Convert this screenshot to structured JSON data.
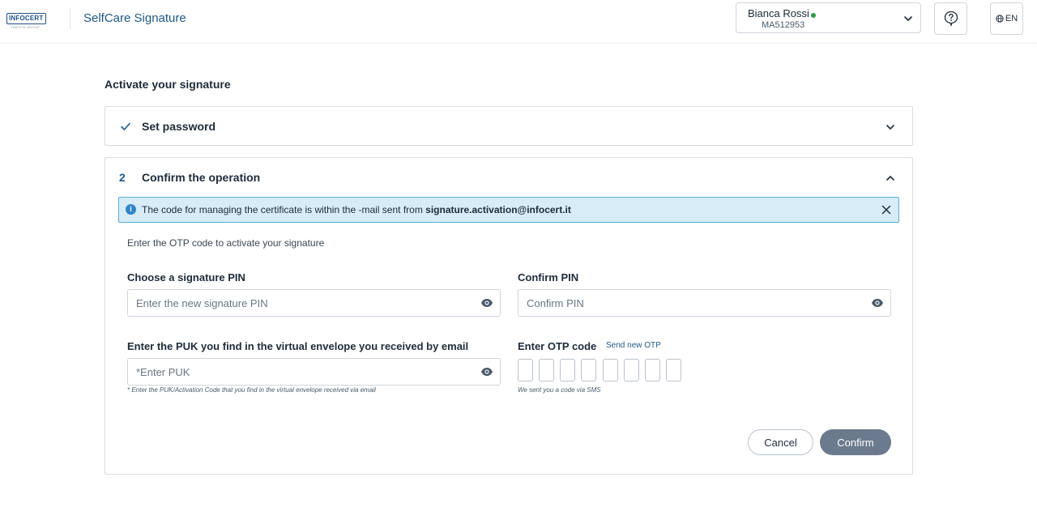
{
  "header": {
    "logo_text": "INFOCERT",
    "logo_sub": "TINEXTA GROUP",
    "app_title": "SelfCare Signature",
    "user": {
      "name": "Bianca Rossi",
      "id": "MA512953",
      "status_color": "#2e9a4a"
    },
    "language": "EN"
  },
  "page": {
    "title": "Activate your signature",
    "steps": [
      {
        "title": "Set password",
        "state": "completed"
      },
      {
        "number": "2",
        "title": "Confirm the operation",
        "state": "open"
      }
    ]
  },
  "banner": {
    "text": "The code for managing the certificate is within the -mail sent from ",
    "email": "signature.activation@infocert.it"
  },
  "form": {
    "intro": "Enter the OTP code to activate your signature",
    "pin": {
      "label": "Choose a signature PIN",
      "placeholder": "Enter the new signature PIN"
    },
    "confirm_pin": {
      "label": "Confirm PIN",
      "placeholder": "Confirm PIN"
    },
    "puk": {
      "label": "Enter the PUK you find in the virtual envelope you received by email",
      "placeholder": "*Enter PUK",
      "hint": "* Enter the PUK/Activation Code that you find in the virtual envelope received via email"
    },
    "otp": {
      "label": "Enter OTP code",
      "send_new": "Send new OTP",
      "hint": "We sent you a code via SMS",
      "digits": 8
    },
    "cancel_label": "Cancel",
    "confirm_label": "Confirm"
  },
  "colors": {
    "accent": "#1f5a8a",
    "banner_bg": "#d7ecf7",
    "banner_border": "#5aaed9",
    "confirm_disabled": "#6b7a8d"
  }
}
